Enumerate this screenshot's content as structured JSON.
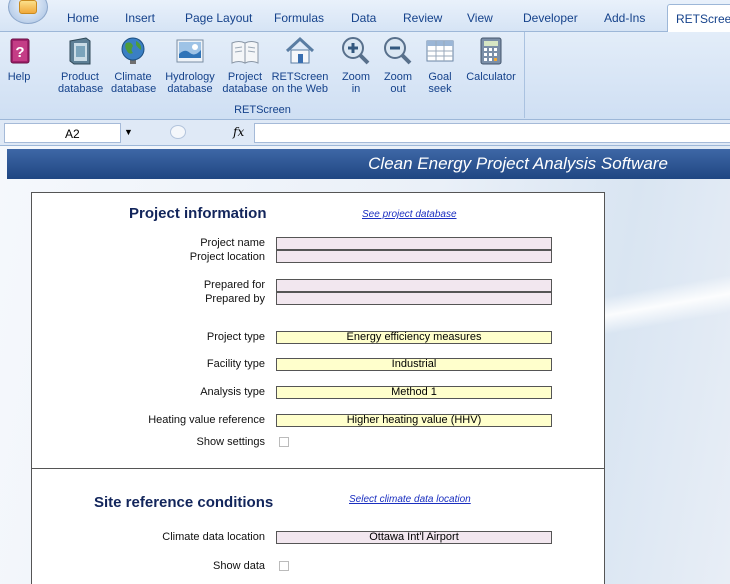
{
  "ribbon": {
    "tabs": [
      "Home",
      "Insert",
      "Page Layout",
      "Formulas",
      "Data",
      "Review",
      "View",
      "Developer",
      "Add-Ins",
      "RETScreen"
    ],
    "active_tab": "RETScreen",
    "group_label": "RETScreen",
    "buttons": [
      {
        "line1": "Help",
        "line2": "",
        "icon": "help-book-icon"
      },
      {
        "line1": "Product",
        "line2": "database",
        "icon": "product-database-icon"
      },
      {
        "line1": "Climate",
        "line2": "database",
        "icon": "globe-icon"
      },
      {
        "line1": "Hydrology",
        "line2": "database",
        "icon": "hydrology-icon"
      },
      {
        "line1": "Project",
        "line2": "database",
        "icon": "open-book-icon"
      },
      {
        "line1": "RETScreen",
        "line2": "on the Web",
        "icon": "home-icon"
      },
      {
        "line1": "Zoom",
        "line2": "in",
        "icon": "zoom-in-icon"
      },
      {
        "line1": "Zoom",
        "line2": "out",
        "icon": "zoom-out-icon"
      },
      {
        "line1": "Goal",
        "line2": "seek",
        "icon": "table-icon"
      },
      {
        "line1": "Calculator",
        "line2": "",
        "icon": "calculator-icon"
      }
    ]
  },
  "formula_bar": {
    "name_box": "A2",
    "fx": "fx",
    "formula": ""
  },
  "banner": {
    "title": "Clean Energy Project Analysis Software"
  },
  "project_info": {
    "heading": "Project information",
    "link": "See project database",
    "project_name_label": "Project name",
    "project_name_value": "",
    "project_location_label": "Project location",
    "project_location_value": "",
    "prepared_for_label": "Prepared for",
    "prepared_for_value": "",
    "prepared_by_label": "Prepared by",
    "prepared_by_value": "",
    "project_type_label": "Project type",
    "project_type_value": "Energy efficiency measures",
    "facility_type_label": "Facility type",
    "facility_type_value": "Industrial",
    "analysis_type_label": "Analysis type",
    "analysis_type_value": "Method 1",
    "heating_value_label": "Heating value reference",
    "heating_value_value": "Higher heating value (HHV)",
    "show_settings_label": "Show settings"
  },
  "site_conditions": {
    "heading": "Site reference conditions",
    "link": "Select climate data location",
    "climate_label": "Climate data location",
    "climate_value": "Ottawa Int'l Airport",
    "show_data_label": "Show data"
  },
  "colors": {
    "accent": "#15428b",
    "banner": "#2a5393",
    "input_fill": "#f2e7ef",
    "selection_fill": "#ffffcc",
    "link": "#1a2fc0"
  }
}
